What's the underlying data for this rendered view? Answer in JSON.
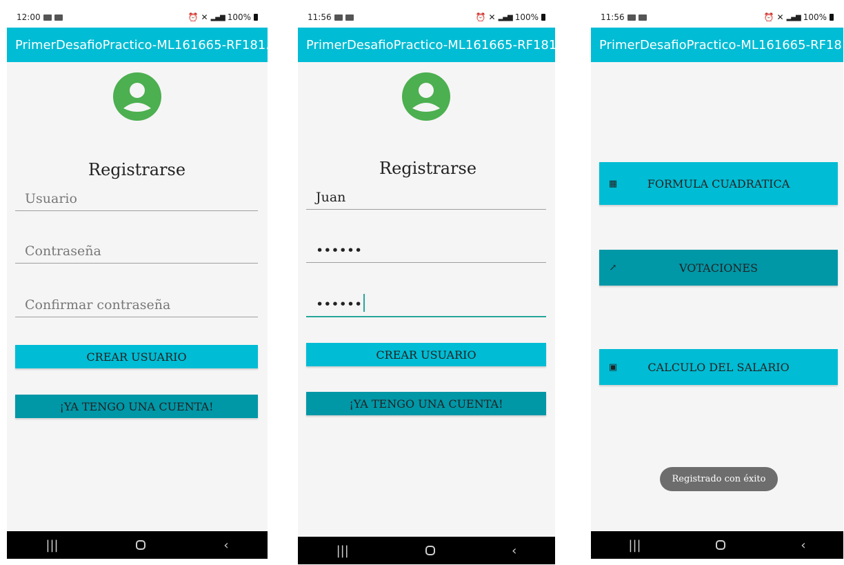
{
  "app_title": "PrimerDesafioPractico-ML161665-RF181...",
  "colors": {
    "primary": "#00bcd4",
    "primary_dark": "#0097a7",
    "avatar": "#4caf50"
  },
  "screen1": {
    "status": {
      "time": "12:00",
      "battery": "100%"
    },
    "title": "Registrarse",
    "usuario_placeholder": "Usuario",
    "contrasena_placeholder": "Contraseña",
    "confirmar_placeholder": "Confirmar contraseña",
    "crear_label": "CREAR USUARIO",
    "ya_tengo_label": "¡YA TENGO UNA CUENTA!"
  },
  "screen2": {
    "status": {
      "time": "11:56",
      "battery": "100%"
    },
    "title": "Registrarse",
    "usuario_value": "Juan",
    "contrasena_value": "••••••",
    "confirmar_value": "••••••",
    "crear_label": "CREAR USUARIO",
    "ya_tengo_label": "¡YA TENGO UNA CUENTA!"
  },
  "screen3": {
    "status": {
      "time": "11:56",
      "battery": "100%"
    },
    "menu": [
      {
        "label": "FORMULA CUADRATICA",
        "icon": "calculator-icon"
      },
      {
        "label": "VOTACIONES",
        "icon": "trending-up-icon"
      },
      {
        "label": "CALCULO DEL SALARIO",
        "icon": "money-icon"
      }
    ],
    "toast": "Registrado con éxito"
  },
  "nav": {
    "recents": "|||",
    "back": "‹"
  }
}
